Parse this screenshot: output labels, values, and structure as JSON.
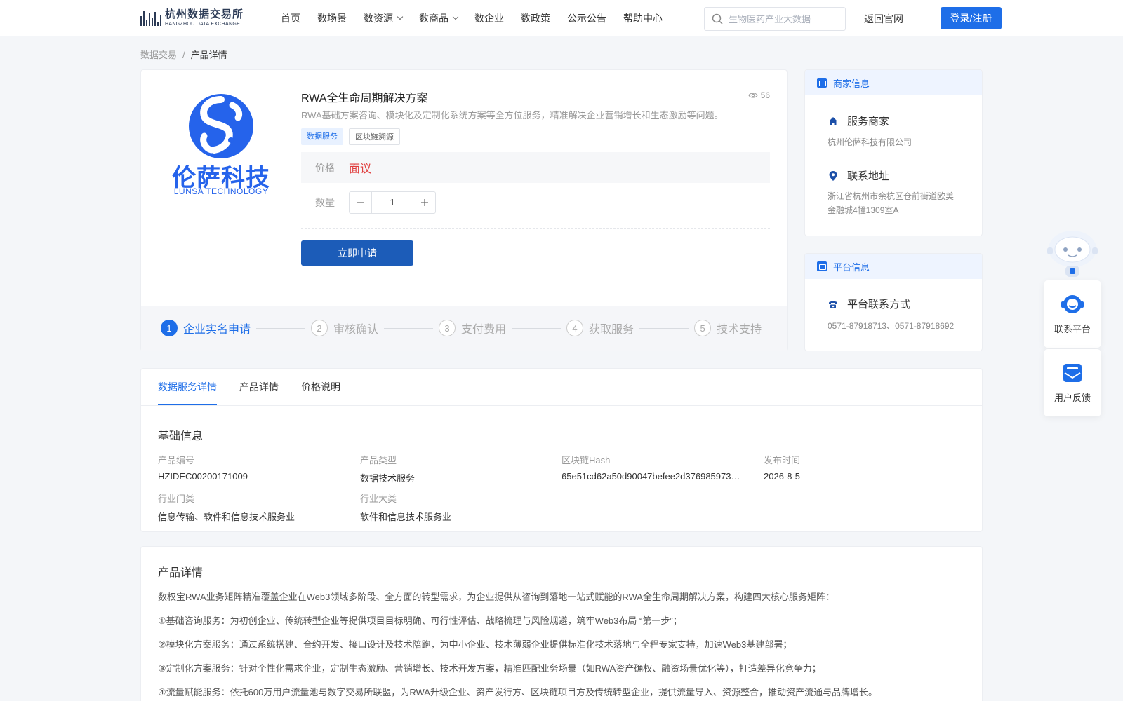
{
  "header": {
    "logo_cn": "杭州数据交易所",
    "logo_en": "HANGZHOU DATA EXCHANGE",
    "nav": [
      {
        "label": "首页",
        "dropdown": false
      },
      {
        "label": "数场景",
        "dropdown": false
      },
      {
        "label": "数资源",
        "dropdown": true
      },
      {
        "label": "数商品",
        "dropdown": true
      },
      {
        "label": "数企业",
        "dropdown": false
      },
      {
        "label": "数政策",
        "dropdown": false
      },
      {
        "label": "公示公告",
        "dropdown": false
      },
      {
        "label": "帮助中心",
        "dropdown": false
      }
    ],
    "search_placeholder": "生物医药产业大数据",
    "back_label": "返回官网",
    "login_label": "登录/注册"
  },
  "breadcrumb": {
    "root": "数据交易",
    "sep": "/",
    "current": "产品详情"
  },
  "product": {
    "logo_cn": "伦萨科技",
    "logo_en": "LUNSA TECHNOLOGY",
    "title": "RWA全生命周期解决方案",
    "views": "56",
    "description": "RWA基础方案咨询、模块化及定制化系统方案等全方位服务，精准解决企业营销增长和生态激励等问题。",
    "tags": [
      "数据服务",
      "区块链溯源"
    ],
    "price_label": "价格",
    "price_value": "面议",
    "qty_label": "数量",
    "qty_value": "1",
    "apply_label": "立即申请",
    "steps": [
      {
        "num": "1",
        "label": "企业实名申请",
        "active": true
      },
      {
        "num": "2",
        "label": "审核确认",
        "active": false
      },
      {
        "num": "3",
        "label": "支付费用",
        "active": false
      },
      {
        "num": "4",
        "label": "获取服务",
        "active": false
      },
      {
        "num": "5",
        "label": "技术支持",
        "active": false
      }
    ]
  },
  "merchant_panel": {
    "title": "商家信息",
    "service_label": "服务商家",
    "service_value": "杭州伦萨科技有限公司",
    "address_label": "联系地址",
    "address_value": "浙江省杭州市余杭区仓前街道欧美金融城4幢1309室A"
  },
  "platform_panel": {
    "title": "平台信息",
    "contact_label": "平台联系方式",
    "contact_value": "0571-87918713、0571-87918692"
  },
  "floating": {
    "contact_label": "联系平台",
    "feedback_label": "用户反馈"
  },
  "detail_tabs": [
    "数据服务详情",
    "产品详情",
    "价格说明"
  ],
  "basic_info": {
    "title": "基础信息",
    "fields": [
      {
        "label": "产品编号",
        "value": "HZIDEC00200171009"
      },
      {
        "label": "产品类型",
        "value": "数据技术服务"
      },
      {
        "label": "区块链Hash",
        "value": "65e51cd62a50d90047befee2d376985973…"
      },
      {
        "label": "发布时间",
        "value": "2026-8-5"
      },
      {
        "label": "行业门类",
        "value": "信息传输、软件和信息技术服务业"
      },
      {
        "label": "行业大类",
        "value": "软件和信息技术服务业"
      }
    ]
  },
  "product_detail": {
    "title": "产品详情",
    "paragraphs": [
      "数权宝RWA业务矩阵精准覆盖企业在Web3领域多阶段、全方面的转型需求，为企业提供从咨询到落地一站式赋能的RWA全生命周期解决方案，构建四大核心服务矩阵：",
      "①基础咨询服务：为初创企业、传统转型企业等提供项目目标明确、可行性评估、战略梳理与风险规避，筑牢Web3布局 “第一步”；",
      "②模块化方案服务：通过系统搭建、合约开发、接口设计及技术陪跑，为中小企业、技术薄弱企业提供标准化技术落地与全程专家支持，加速Web3基建部署；",
      "③定制化方案服务：针对个性化需求企业，定制生态激励、营销增长、技术开发方案，精准匹配业务场景（如RWA资产确权、融资场景优化等），打造差异化竞争力；",
      "④流量赋能服务：依托600万用户流量池与数字交易所联盟，为RWA升级企业、资产发行方、区块链项目方及传统转型企业，提供流量导入、资源整合，推动资产流通与品牌增长。"
    ]
  },
  "colors": {
    "primary": "#1e6ee8",
    "apply": "#1c5cb8",
    "price": "#e03b3b"
  }
}
